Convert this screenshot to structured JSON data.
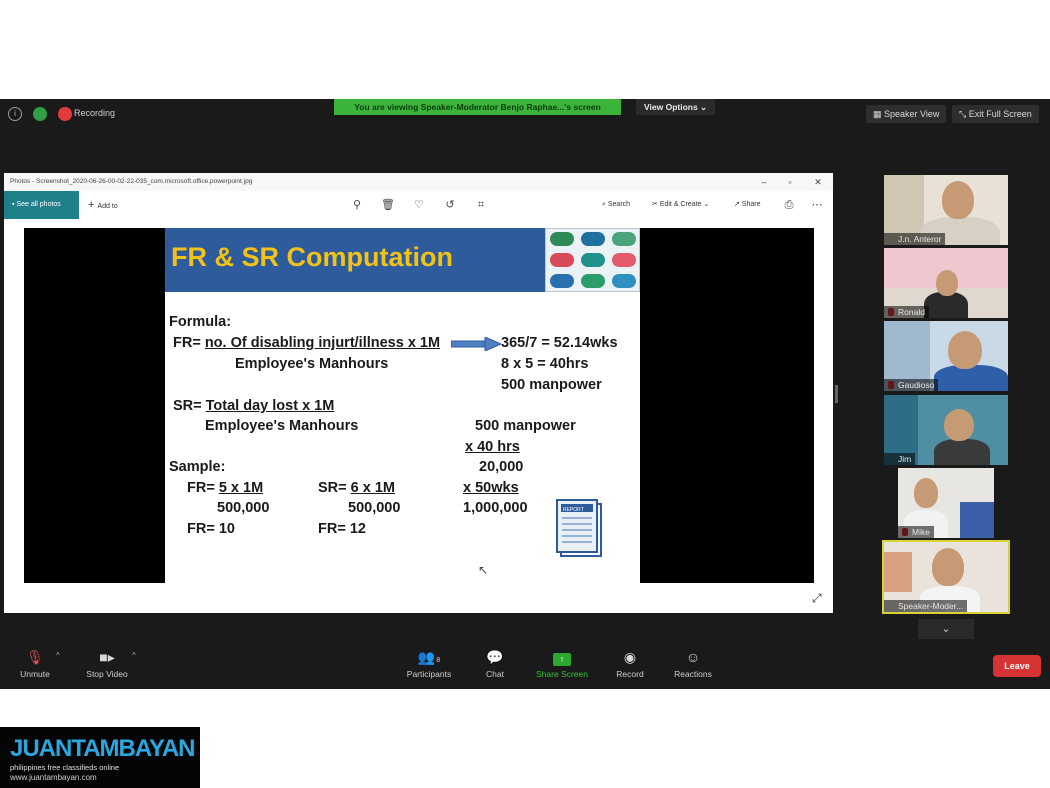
{
  "zoom": {
    "recording_label": "Recording",
    "viewing_banner": "You are viewing Speaker-Moderator Benjo Raphae...'s screen",
    "view_options": "View Options ⌄",
    "speaker_view": "Speaker View",
    "exit_full_screen": "Exit Full Screen",
    "participants_count": "8",
    "leave": "Leave",
    "bottom": {
      "unmute": "Unmute",
      "stop_video": "Stop Video",
      "participants": "Participants",
      "chat": "Chat",
      "share_screen": "Share Screen",
      "record": "Record",
      "reactions": "Reactions"
    },
    "participants": [
      {
        "name": "J.n. Anteror"
      },
      {
        "name": "Ronald"
      },
      {
        "name": "Gaudioso"
      },
      {
        "name": "Jim"
      },
      {
        "name": "Mike"
      },
      {
        "name": "Speaker-Moder..."
      }
    ]
  },
  "photos_app": {
    "title": "Photos - Screenshot_2020-06-26-00-02-22-035_com.microsoft.office.powerpoint.jpg",
    "see_all": "See all photos",
    "add_to": "Add to",
    "search": "Search",
    "edit_create": "Edit & Create ⌄",
    "share": "Share"
  },
  "slide": {
    "title": "FR & SR Computation",
    "formula": "Formula:",
    "fr_prefix": "FR=",
    "fr_numerator": "no. Of disabling injurt/illness x 1M",
    "fr_denominator": "Employee's Manhours",
    "calc1": "365/7 = 52.14wks",
    "calc2": "8 x 5  = 40hrs",
    "calc3": "500 manpower",
    "sr_prefix": "SR=",
    "sr_numerator": "Total day lost x 1M",
    "sr_denominator": "Employee's Manhours",
    "mult1": "500 manpower",
    "mult2": "x  40 hrs",
    "mult3": "20,000",
    "mult4": "x  50wks",
    "mult5": "1,000,000",
    "sample": "Sample:",
    "s_fr_prefix": "FR=",
    "s_fr_num": "5 x 1M",
    "s_fr_den": "500,000",
    "s_fr_result": "FR= 10",
    "s_sr_prefix": "SR=",
    "s_sr_num": "6 x 1M",
    "s_sr_den": "500,000",
    "s_sr_result": "FR= 12",
    "report_label": "REPORT"
  },
  "watermark": {
    "brand": "JUANTAMBAYAN",
    "tagline": "philippines        free classifieds online",
    "url": "www.juantambayan.com"
  }
}
